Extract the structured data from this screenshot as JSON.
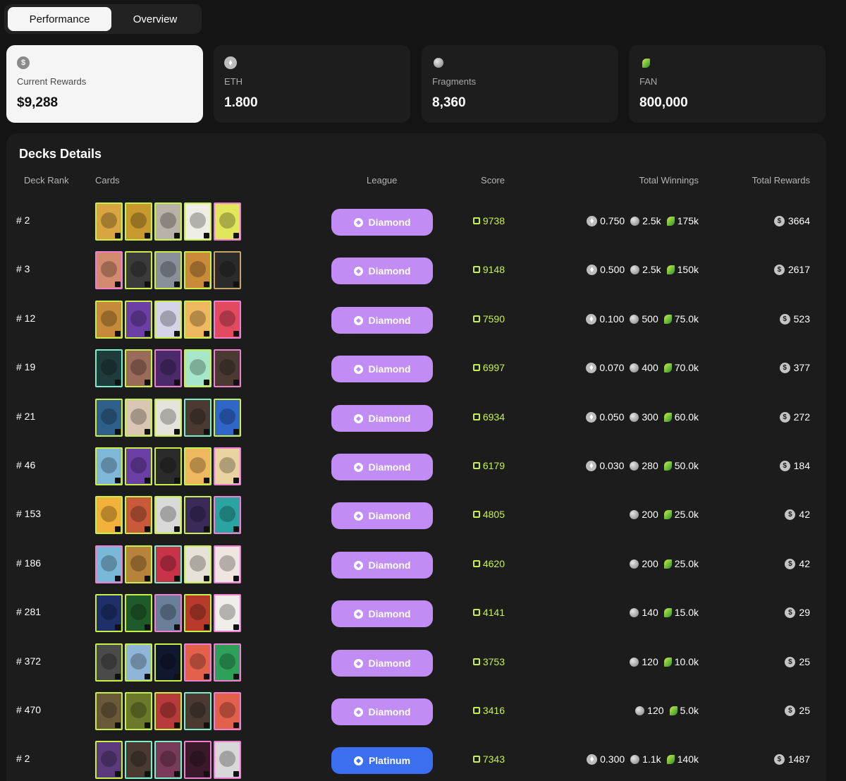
{
  "tabs": [
    {
      "label": "Performance",
      "active": true
    },
    {
      "label": "Overview",
      "active": false
    }
  ],
  "stats": [
    {
      "icon": "dollar-icon",
      "label": "Current Rewards",
      "value": "$9,288",
      "active": true
    },
    {
      "icon": "eth-icon",
      "label": "ETH",
      "value": "1.800",
      "active": false
    },
    {
      "icon": "fragment-icon",
      "label": "Fragments",
      "value": "8,360",
      "active": false
    },
    {
      "icon": "fan-icon",
      "label": "FAN",
      "value": "800,000",
      "active": false
    }
  ],
  "decks": {
    "title": "Decks Details",
    "headers": {
      "rank": "Deck Rank",
      "cards": "Cards",
      "league": "League",
      "score": "Score",
      "winnings": "Total Winnings",
      "rewards": "Total Rewards"
    },
    "rows": [
      {
        "rank": "# 2",
        "league": "Diamond",
        "score": "9738",
        "eth": "0.750",
        "fragments": "2.5k",
        "fan": "175k",
        "rewards": "3664",
        "cards": [
          {
            "bg": "#d9a542",
            "frame": "#c9f04a"
          },
          {
            "bg": "#c89a2e",
            "frame": "#c9f04a"
          },
          {
            "bg": "#b9b2a8",
            "frame": "#c9f04a"
          },
          {
            "bg": "#f0ede6",
            "frame": "#c9f04a"
          },
          {
            "bg": "#e2e65a",
            "frame": "#ef7fd0"
          }
        ]
      },
      {
        "rank": "# 3",
        "league": "Diamond",
        "score": "9148",
        "eth": "0.500",
        "fragments": "2.5k",
        "fan": "150k",
        "rewards": "2617",
        "cards": [
          {
            "bg": "#d38a6e",
            "frame": "#ef7fd0"
          },
          {
            "bg": "#3b3b3b",
            "frame": "#c9f04a"
          },
          {
            "bg": "#8a8f9c",
            "frame": "#c9f04a"
          },
          {
            "bg": "#c98a3a",
            "frame": "#c9f04a"
          },
          {
            "bg": "#2b2b2b",
            "frame": "#c9a46a"
          }
        ]
      },
      {
        "rank": "# 12",
        "league": "Diamond",
        "score": "7590",
        "eth": "0.100",
        "fragments": "500",
        "fan": "75.0k",
        "rewards": "523",
        "cards": [
          {
            "bg": "#c68a3a",
            "frame": "#c9f04a"
          },
          {
            "bg": "#6b3fa6",
            "frame": "#c9f04a"
          },
          {
            "bg": "#d5d3ea",
            "frame": "#c9f04a"
          },
          {
            "bg": "#efb760",
            "frame": "#c9f04a"
          },
          {
            "bg": "#e24a5f",
            "frame": "#ef7fd0"
          }
        ]
      },
      {
        "rank": "# 19",
        "league": "Diamond",
        "score": "6997",
        "eth": "0.070",
        "fragments": "400",
        "fan": "70.0k",
        "rewards": "377",
        "cards": [
          {
            "bg": "#1f3b3b",
            "frame": "#7ef0c9"
          },
          {
            "bg": "#9a6a5a",
            "frame": "#c9f04a"
          },
          {
            "bg": "#4a2a6a",
            "frame": "#ef7fd0"
          },
          {
            "bg": "#a7e7c9",
            "frame": "#c9f04a"
          },
          {
            "bg": "#4a3a32",
            "frame": "#ef7fd0"
          }
        ]
      },
      {
        "rank": "# 21",
        "league": "Diamond",
        "score": "6934",
        "eth": "0.050",
        "fragments": "300",
        "fan": "60.0k",
        "rewards": "272",
        "cards": [
          {
            "bg": "#2e5f8a",
            "frame": "#c9f04a"
          },
          {
            "bg": "#d9c6b5",
            "frame": "#c9f04a"
          },
          {
            "bg": "#e6e3dc",
            "frame": "#c9f04a"
          },
          {
            "bg": "#4a3a32",
            "frame": "#7ef0c9"
          },
          {
            "bg": "#2f66c8",
            "frame": "#c9f04a"
          }
        ]
      },
      {
        "rank": "# 46",
        "league": "Diamond",
        "score": "6179",
        "eth": "0.030",
        "fragments": "280",
        "fan": "50.0k",
        "rewards": "184",
        "cards": [
          {
            "bg": "#7fb7d8",
            "frame": "#c9f04a"
          },
          {
            "bg": "#6a3fa6",
            "frame": "#c9f04a"
          },
          {
            "bg": "#2b2b2b",
            "frame": "#c9f04a"
          },
          {
            "bg": "#efb760",
            "frame": "#c9f04a"
          },
          {
            "bg": "#e9d3a0",
            "frame": "#ef7fd0"
          }
        ]
      },
      {
        "rank": "# 153",
        "league": "Diamond",
        "score": "4805",
        "eth": "",
        "fragments": "200",
        "fan": "25.0k",
        "rewards": "42",
        "cards": [
          {
            "bg": "#f2b13a",
            "frame": "#c9f04a"
          },
          {
            "bg": "#c85a3a",
            "frame": "#c9f04a"
          },
          {
            "bg": "#d9d9d9",
            "frame": "#c9f04a"
          },
          {
            "bg": "#3a2a5a",
            "frame": "#c9f04a"
          },
          {
            "bg": "#2aa4a0",
            "frame": "#ef7fd0"
          }
        ]
      },
      {
        "rank": "# 186",
        "league": "Diamond",
        "score": "4620",
        "eth": "",
        "fragments": "200",
        "fan": "25.0k",
        "rewards": "42",
        "cards": [
          {
            "bg": "#7ab8d8",
            "frame": "#ef7fd0"
          },
          {
            "bg": "#b7833a",
            "frame": "#c9f04a"
          },
          {
            "bg": "#c8334a",
            "frame": "#7ef0c9"
          },
          {
            "bg": "#e7e2d8",
            "frame": "#c9f04a"
          },
          {
            "bg": "#efe6e0",
            "frame": "#ef7fd0"
          }
        ]
      },
      {
        "rank": "# 281",
        "league": "Diamond",
        "score": "4141",
        "eth": "",
        "fragments": "140",
        "fan": "15.0k",
        "rewards": "29",
        "cards": [
          {
            "bg": "#1f2f6a",
            "frame": "#c9f04a"
          },
          {
            "bg": "#1f5a2a",
            "frame": "#c9f04a"
          },
          {
            "bg": "#6a7f9a",
            "frame": "#ef7fd0"
          },
          {
            "bg": "#b83a2a",
            "frame": "#c9f04a"
          },
          {
            "bg": "#f0eee8",
            "frame": "#ef7fd0"
          }
        ]
      },
      {
        "rank": "# 372",
        "league": "Diamond",
        "score": "3753",
        "eth": "",
        "fragments": "120",
        "fan": "10.0k",
        "rewards": "25",
        "cards": [
          {
            "bg": "#4a4a4a",
            "frame": "#c9f04a"
          },
          {
            "bg": "#8fb5d8",
            "frame": "#c9f04a"
          },
          {
            "bg": "#101830",
            "frame": "#c9f04a"
          },
          {
            "bg": "#e3614a",
            "frame": "#ef7fd0"
          },
          {
            "bg": "#2fa05a",
            "frame": "#ef7fd0"
          }
        ]
      },
      {
        "rank": "# 470",
        "league": "Diamond",
        "score": "3416",
        "eth": "",
        "fragments": "120",
        "fan": "5.0k",
        "rewards": "25",
        "cards": [
          {
            "bg": "#6a5a3a",
            "frame": "#c9f04a"
          },
          {
            "bg": "#6a7a2a",
            "frame": "#c9f04a"
          },
          {
            "bg": "#b83a3a",
            "frame": "#c9f04a"
          },
          {
            "bg": "#4a3a32",
            "frame": "#7ef0c9"
          },
          {
            "bg": "#e3614a",
            "frame": "#ef7fd0"
          }
        ]
      },
      {
        "rank": "# 2",
        "league": "Platinum",
        "score": "7343",
        "eth": "0.300",
        "fragments": "1.1k",
        "fan": "140k",
        "rewards": "1487",
        "cards": [
          {
            "bg": "#5a3a7a",
            "frame": "#c9f04a"
          },
          {
            "bg": "#4a3a32",
            "frame": "#7ef0c9"
          },
          {
            "bg": "#7a3a5a",
            "frame": "#7ef0c9"
          },
          {
            "bg": "#3a1a2a",
            "frame": "#ef7fd0"
          },
          {
            "bg": "#d8d8d8",
            "frame": "#ef7fd0"
          }
        ]
      }
    ]
  },
  "colors": {
    "diamond": "#c18cf3",
    "platinum": "#3c6ef0",
    "score": "#c9f04a"
  }
}
